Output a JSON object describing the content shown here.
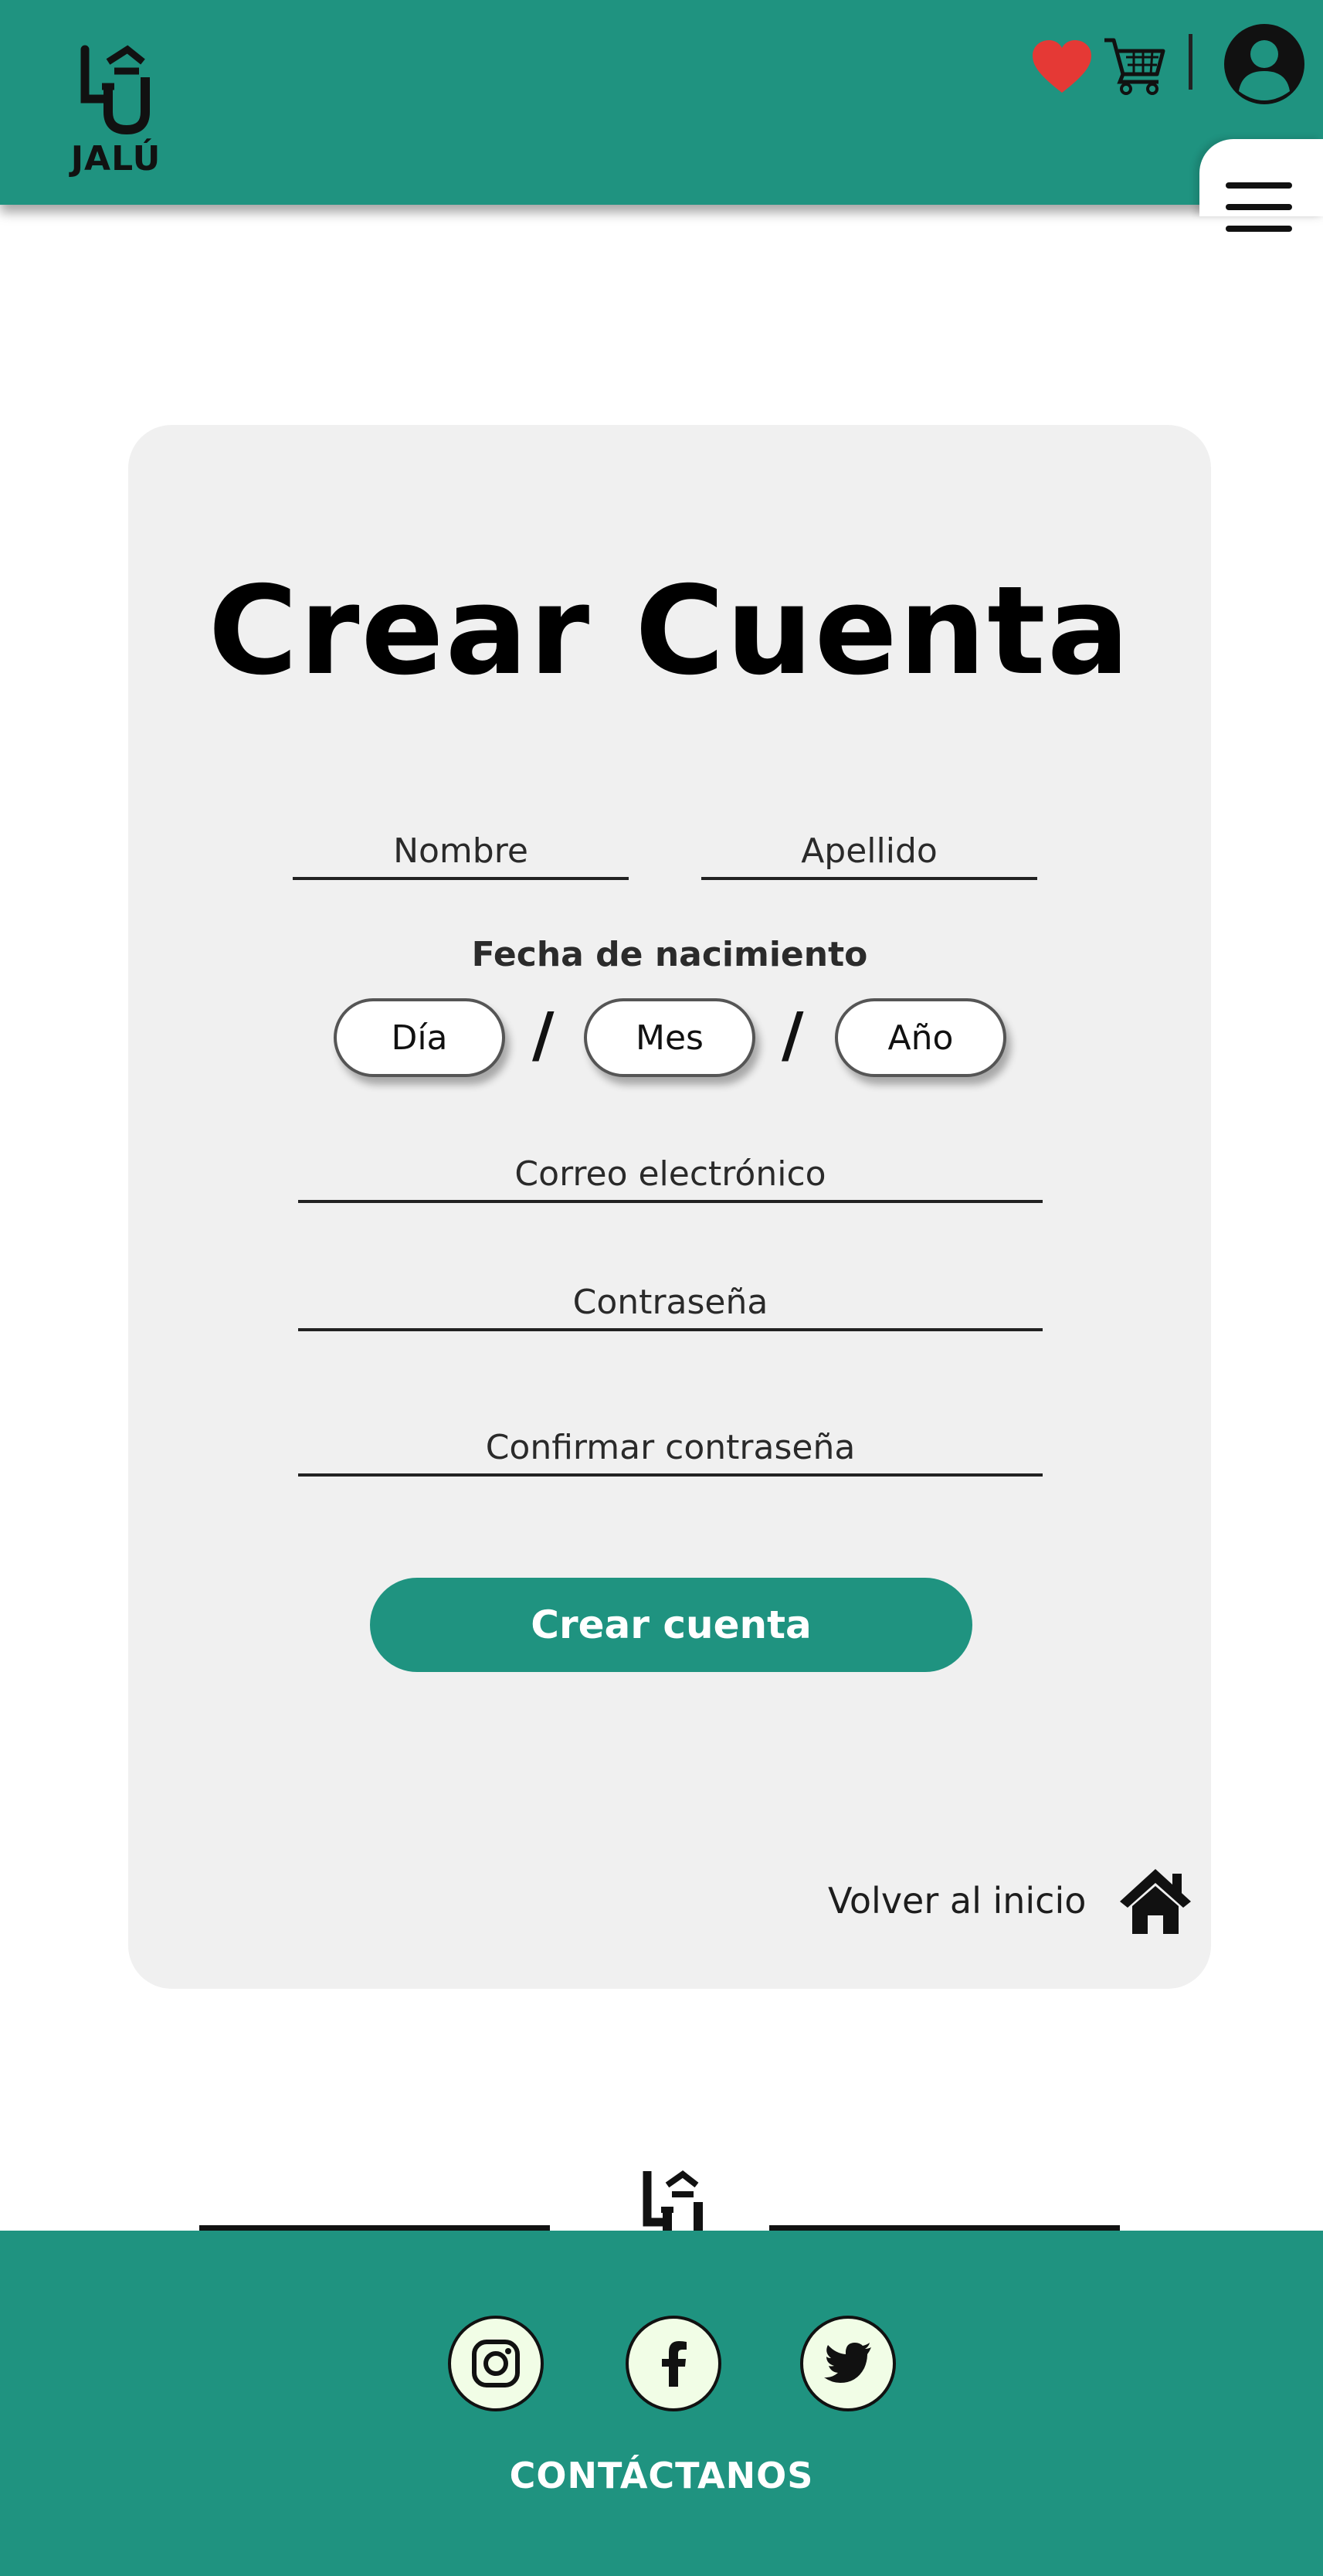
{
  "header": {
    "brand": "JALÚ",
    "icons": [
      "heart-icon",
      "cart-icon",
      "user-icon",
      "hamburger-menu-icon"
    ]
  },
  "form": {
    "title": "Crear Cuenta",
    "first_name_placeholder": "Nombre",
    "last_name_placeholder": "Apellido",
    "birthdate_label": "Fecha de nacimiento",
    "day_placeholder": "Día",
    "month_placeholder": "Mes",
    "year_placeholder": "Año",
    "date_separator": "/",
    "email_placeholder": "Correo electrónico",
    "password_placeholder": "Contraseña",
    "confirm_password_placeholder": "Confirmar contraseña",
    "submit_label": "Crear cuenta",
    "back_home_label": "Volver al inicio"
  },
  "footer": {
    "social": [
      "instagram-icon",
      "facebook-icon",
      "twitter-icon"
    ],
    "contact_label": "CONTÁCTANOS"
  },
  "colors": {
    "brand_teal": "#1f9380",
    "heart_red": "#e53935",
    "card_bg": "#f0f0f0",
    "social_bg": "#f1fde6"
  }
}
